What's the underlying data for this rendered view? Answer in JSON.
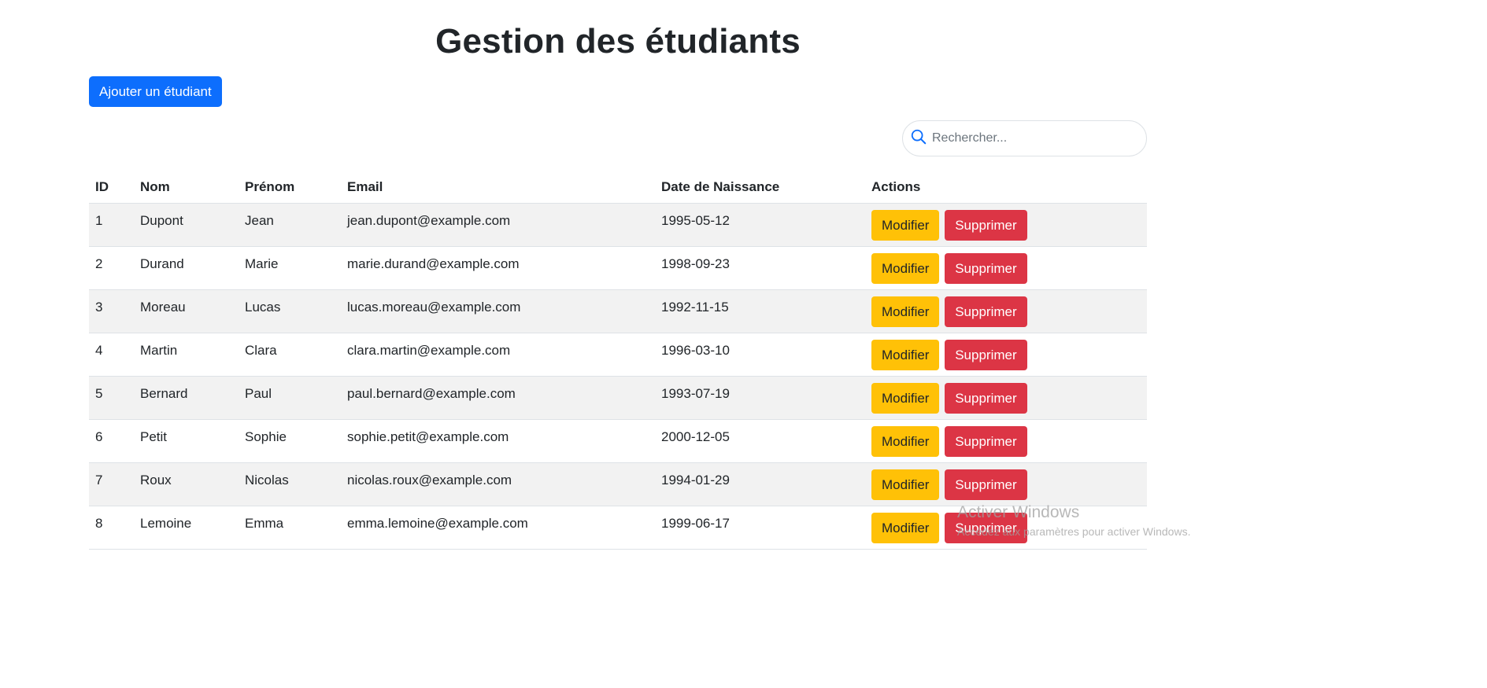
{
  "page": {
    "title": "Gestion des étudiants",
    "add_button": "Ajouter un étudiant"
  },
  "search": {
    "placeholder": "Rechercher...",
    "icon": "search-icon"
  },
  "table": {
    "headers": {
      "id": "ID",
      "nom": "Nom",
      "prenom": "Prénom",
      "email": "Email",
      "date": "Date de Naissance",
      "actions": "Actions"
    },
    "rows": [
      {
        "id": "1",
        "nom": "Dupont",
        "prenom": "Jean",
        "email": "jean.dupont@example.com",
        "date": "1995-05-12",
        "edit": "Modifier",
        "delete": "Supprimer"
      },
      {
        "id": "2",
        "nom": "Durand",
        "prenom": "Marie",
        "email": "marie.durand@example.com",
        "date": "1998-09-23",
        "edit": "Modifier",
        "delete": "Supprimer"
      },
      {
        "id": "3",
        "nom": "Moreau",
        "prenom": "Lucas",
        "email": "lucas.moreau@example.com",
        "date": "1992-11-15",
        "edit": "Modifier",
        "delete": "Supprimer"
      },
      {
        "id": "4",
        "nom": "Martin",
        "prenom": "Clara",
        "email": "clara.martin@example.com",
        "date": "1996-03-10",
        "edit": "Modifier",
        "delete": "Supprimer"
      },
      {
        "id": "5",
        "nom": "Bernard",
        "prenom": "Paul",
        "email": "paul.bernard@example.com",
        "date": "1993-07-19",
        "edit": "Modifier",
        "delete": "Supprimer"
      },
      {
        "id": "6",
        "nom": "Petit",
        "prenom": "Sophie",
        "email": "sophie.petit@example.com",
        "date": "2000-12-05",
        "edit": "Modifier",
        "delete": "Supprimer"
      },
      {
        "id": "7",
        "nom": "Roux",
        "prenom": "Nicolas",
        "email": "nicolas.roux@example.com",
        "date": "1994-01-29",
        "edit": "Modifier",
        "delete": "Supprimer"
      },
      {
        "id": "8",
        "nom": "Lemoine",
        "prenom": "Emma",
        "email": "emma.lemoine@example.com",
        "date": "1999-06-17",
        "edit": "Modifier",
        "delete": "Supprimer"
      }
    ]
  },
  "watermark": {
    "title": "Activer Windows",
    "subtitle": "Accédez aux paramètres pour activer Windows."
  },
  "colors": {
    "primary": "#0d6efd",
    "warning": "#ffc107",
    "danger": "#dc3545",
    "striped_row": "#f2f2f2"
  }
}
